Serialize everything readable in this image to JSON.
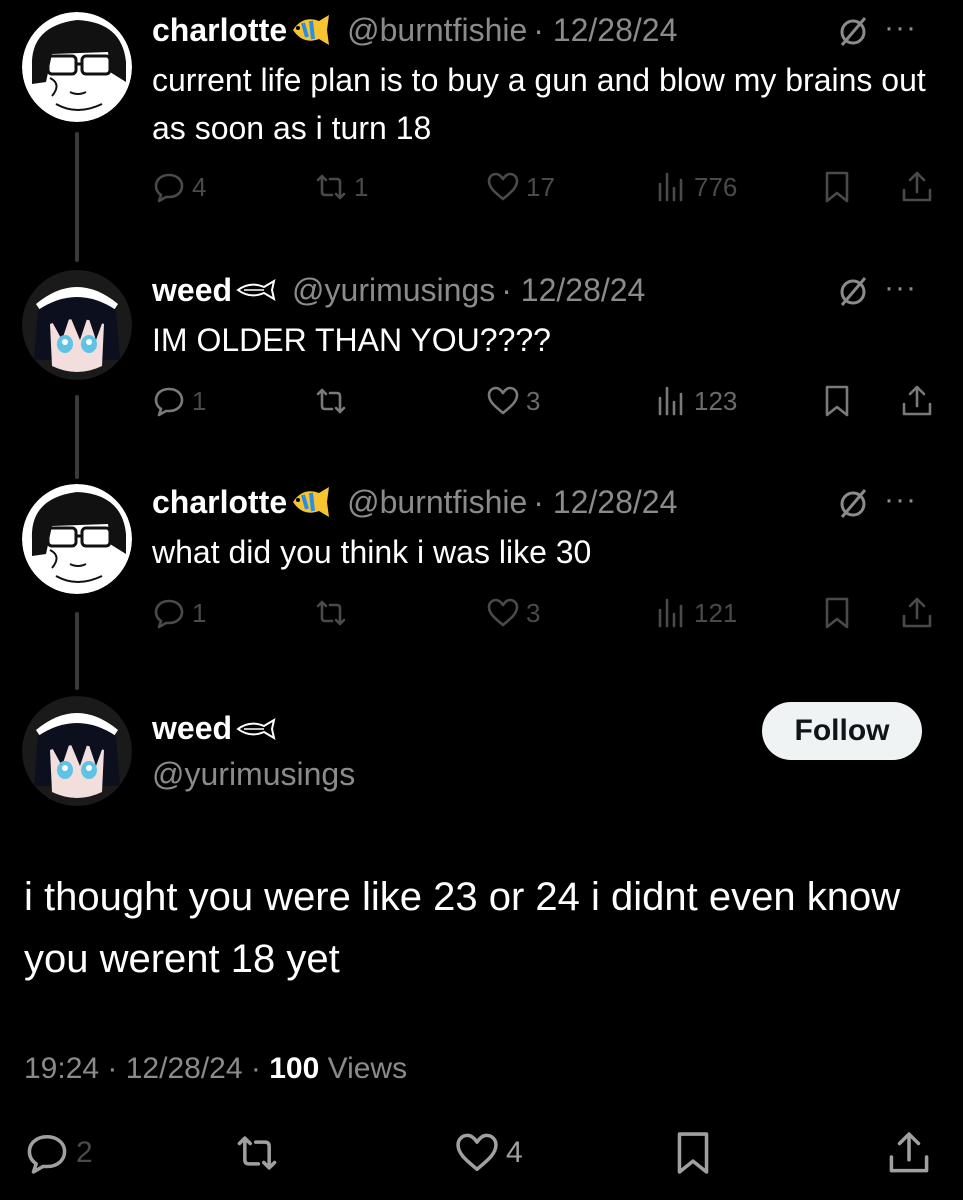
{
  "tweets": [
    {
      "name": "charlotte",
      "handle": "@burntfishie",
      "date": "· 12/28/24",
      "text": "current life plan is to buy a gun and blow my brains out as soon as i turn 18",
      "replies": "4",
      "reposts": "1",
      "likes": "17",
      "views": "776"
    },
    {
      "name": "weed",
      "handle": "@yurimusings",
      "date": "· 12/28/24",
      "text": "IM OLDER THAN YOU????",
      "replies": "1",
      "reposts": "",
      "likes": "3",
      "views": "123"
    },
    {
      "name": "charlotte",
      "handle": "@burntfishie",
      "date": "· 12/28/24",
      "text": "what did you think i was like 30",
      "replies": "1",
      "reposts": "",
      "likes": "3",
      "views": "121"
    }
  ],
  "main": {
    "name": "weed",
    "handle": "@yurimusings",
    "follow_label": "Follow",
    "text": "i thought you were like 23 or 24  i didnt even know you werent 18 yet",
    "time": "19:24",
    "date": "12/28/24",
    "views_count": "100",
    "views_label": "Views",
    "replies": "2",
    "likes": "4"
  },
  "colors": {
    "background": "#000000",
    "text": "#ffffff",
    "secondary": "#8b8b8b",
    "follow_bg": "#eff3f4"
  }
}
